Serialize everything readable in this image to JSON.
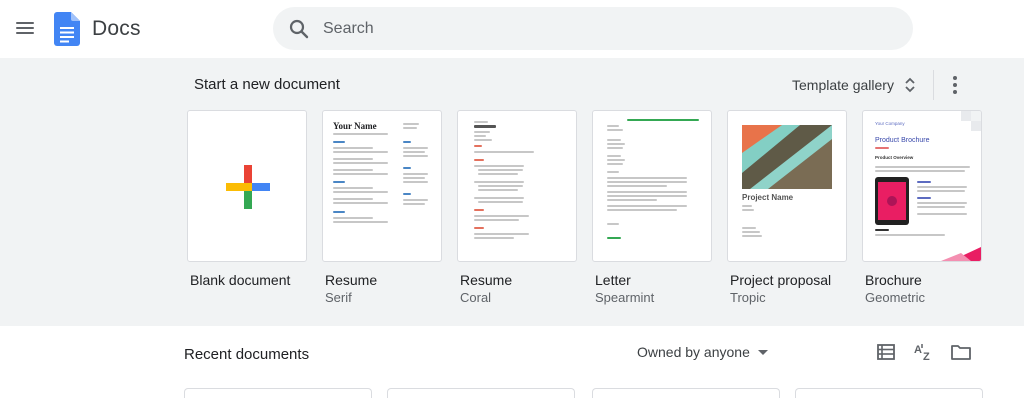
{
  "app": {
    "title": "Docs",
    "brand_color": "#4285f4"
  },
  "search": {
    "placeholder": "Search",
    "value": ""
  },
  "templates": {
    "heading": "Start a new document",
    "gallery_label": "Template gallery",
    "items": [
      {
        "name": "Blank document",
        "subtitle": ""
      },
      {
        "name": "Resume",
        "subtitle": "Serif"
      },
      {
        "name": "Resume",
        "subtitle": "Coral"
      },
      {
        "name": "Letter",
        "subtitle": "Spearmint"
      },
      {
        "name": "Project proposal",
        "subtitle": "Tropic"
      },
      {
        "name": "Brochure",
        "subtitle": "Geometric"
      }
    ],
    "previews": {
      "serif_name": "Your Name",
      "proposal_title": "Project Name",
      "brochure_company": "Your Company",
      "brochure_title": "Product Brochure",
      "brochure_overview": "Product Overview"
    }
  },
  "recent": {
    "heading": "Recent documents",
    "owner_filter": "Owned by anyone"
  },
  "icons": {
    "menu": "menu-icon",
    "search": "search-icon",
    "expand": "unfold-icon",
    "more": "more-vert-icon",
    "list_view": "list-view-icon",
    "sort": "sort-az-icon",
    "folder": "folder-icon"
  }
}
